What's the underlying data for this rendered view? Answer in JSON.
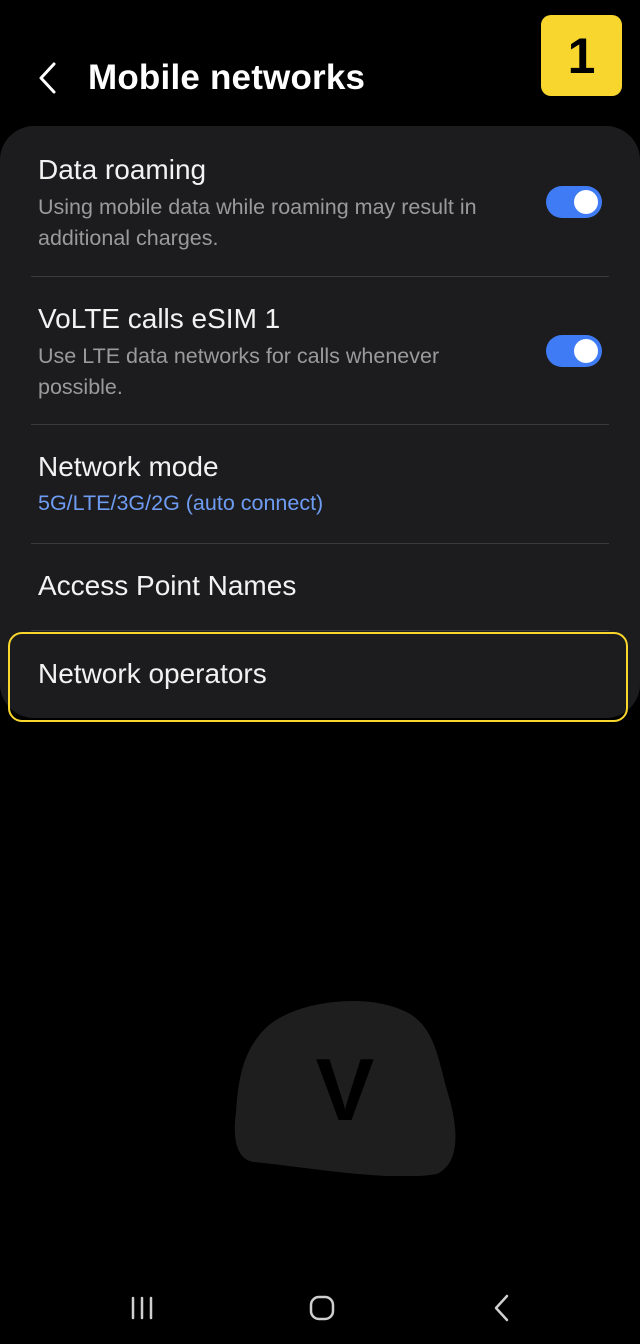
{
  "header": {
    "title": "Mobile networks",
    "step_badge": "1",
    "back_icon": "chevron-left-icon"
  },
  "settings": [
    {
      "title": "Data roaming",
      "subtitle": "Using mobile data while roaming may result in additional charges.",
      "toggle": true
    },
    {
      "title": "VoLTE calls eSIM 1",
      "subtitle": "Use LTE data networks for calls whenever possible.",
      "toggle": true
    },
    {
      "title": "Network mode",
      "subtitle": "5G/LTE/3G/2G (auto connect)"
    },
    {
      "title": "Access Point Names"
    },
    {
      "title": "Network operators",
      "highlighted": true
    }
  ],
  "watermark": {
    "letter": "V"
  },
  "nav_bar": {
    "recents_icon": "recents-icon",
    "home_icon": "home-icon",
    "back_icon": "back-icon"
  },
  "colors": {
    "background": "#000000",
    "card": "#1c1c1e",
    "accent_blue": "#3e7bf4",
    "link_blue": "#6e9cf2",
    "highlight_yellow": "#f8d62e"
  }
}
